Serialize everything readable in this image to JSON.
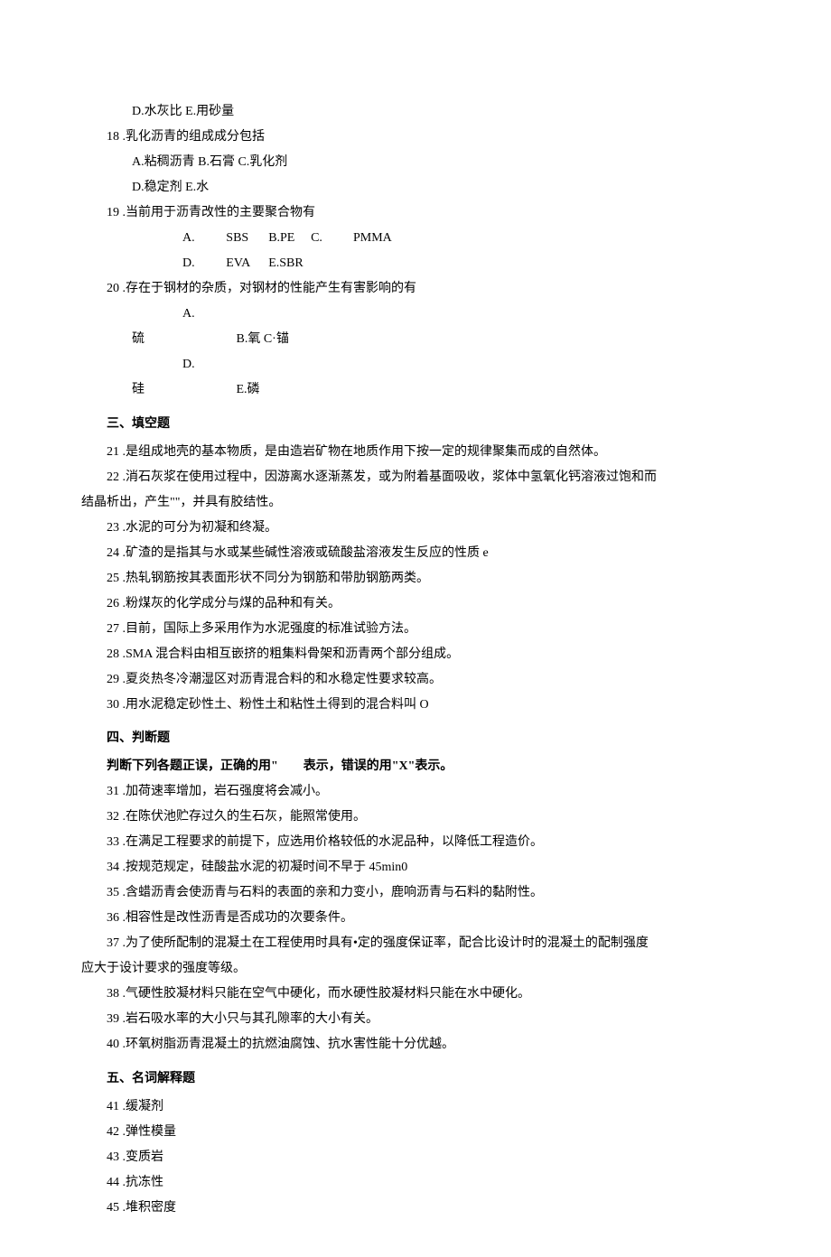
{
  "q17_cont": {
    "d": "D.水灰比 E.用砂量"
  },
  "q18": {
    "num": "18",
    "stem": ".乳化沥青的组成成分包括",
    "line1": "A.粘稠沥青 B.石膏 C.乳化剂",
    "line2": "D.稳定剂 E.水"
  },
  "q19": {
    "num": "19",
    "stem": ".当前用于沥青改性的主要聚合物有",
    "row1": {
      "a": "A.",
      "av": "SBS",
      "b": "B.PE",
      "c": "C.",
      "cv": "PMMA"
    },
    "row2": {
      "a": "D.",
      "av": "EVA",
      "b": "E.SBR"
    }
  },
  "q20": {
    "num": "20",
    "stem": ".存在于钢材的杂质，对钢材的性能产生有害影响的有",
    "row1": {
      "a": "A.硫",
      "b": "B.氧 C·锚"
    },
    "row2": {
      "a": "D.硅",
      "b": "E.磷"
    }
  },
  "sec3": "三、填空题",
  "fill": {
    "q21": {
      "n": "21",
      "t": ".是组成地壳的基本物质，是由造岩矿物在地质作用下按一定的规律聚集而成的自然体。"
    },
    "q22": {
      "n": "22",
      "t1": ".消石灰浆在使用过程中，因游离水逐渐蒸发，或为附着基面吸收，浆体中氢氧化钙溶液过饱和而",
      "t2": "结晶析出，产生\"\"，并具有胶结性。"
    },
    "q23": {
      "n": "23",
      "t": ".水泥的可分为初凝和终凝。"
    },
    "q24": {
      "n": "24",
      "t": ".矿渣的是指其与水或某些碱性溶液或硫酸盐溶液发生反应的性质 e"
    },
    "q25": {
      "n": "25",
      "t": ".热轧钢筋按其表面形状不同分为钢筋和带肋钢筋两类。"
    },
    "q26": {
      "n": "26",
      "t": ".粉煤灰的化学成分与煤的品种和有关。"
    },
    "q27": {
      "n": "27",
      "t": ".目前，国际上多采用作为水泥强度的标准试验方法。"
    },
    "q28": {
      "n": "28",
      "t": ".SMA 混合料由相互嵌挤的粗集料骨架和沥青两个部分组成。"
    },
    "q29": {
      "n": "29",
      "t": ".夏炎热冬冷潮湿区对沥青混合料的和水稳定性要求较高。"
    },
    "q30": {
      "n": "30",
      "t": ".用水泥稳定砂性土、粉性土和粘性土得到的混合料叫 O"
    }
  },
  "sec4": "四、判断题",
  "sec4_sub": "判断下列各题正误，正确的用\"　　表示，错误的用\"X\"表示。",
  "judge": {
    "q31": {
      "n": "31",
      "t": ".加荷速率增加，岩石强度将会减小。"
    },
    "q32": {
      "n": "32",
      "t": ".在陈伏池贮存过久的生石灰，能照常使用。"
    },
    "q33": {
      "n": "33",
      "t": ".在满足工程要求的前提下，应选用价格较低的水泥品种，以降低工程造价。"
    },
    "q34": {
      "n": "34",
      "t": ".按规范规定，硅酸盐水泥的初凝时间不早于 45min0"
    },
    "q35": {
      "n": "35",
      "t": ".含蜡沥青会使沥青与石料的表面的亲和力变小，鹿响沥青与石料的黏附性。"
    },
    "q36": {
      "n": "36",
      "t": ".相容性是改性沥青是否成功的次要条件。"
    },
    "q37": {
      "n": "37",
      "t1": ".为了使所配制的混凝土在工程使用时具有•定的强度保证率，配合比设计时的混凝土的配制强度",
      "t2": "应大于设计要求的强度等级。"
    },
    "q38": {
      "n": "38",
      "t": ".气硬性胶凝材料只能在空气中硬化，而水硬性胶凝材料只能在水中硬化。"
    },
    "q39": {
      "n": "39",
      "t": ".岩石吸水率的大小只与其孔隙率的大小有关。"
    },
    "q40": {
      "n": "40",
      "t": ".环氧树脂沥青混凝土的抗燃油腐蚀、抗水害性能十分优越。"
    }
  },
  "sec5": "五、名词解释题",
  "terms": {
    "q41": {
      "n": "41",
      "t": ".缓凝剂"
    },
    "q42": {
      "n": "42",
      "t": ".弹性模量"
    },
    "q43": {
      "n": "43",
      "t": ".变质岩"
    },
    "q44": {
      "n": "44",
      "t": ".抗冻性"
    },
    "q45": {
      "n": "45",
      "t": ".堆积密度"
    }
  }
}
